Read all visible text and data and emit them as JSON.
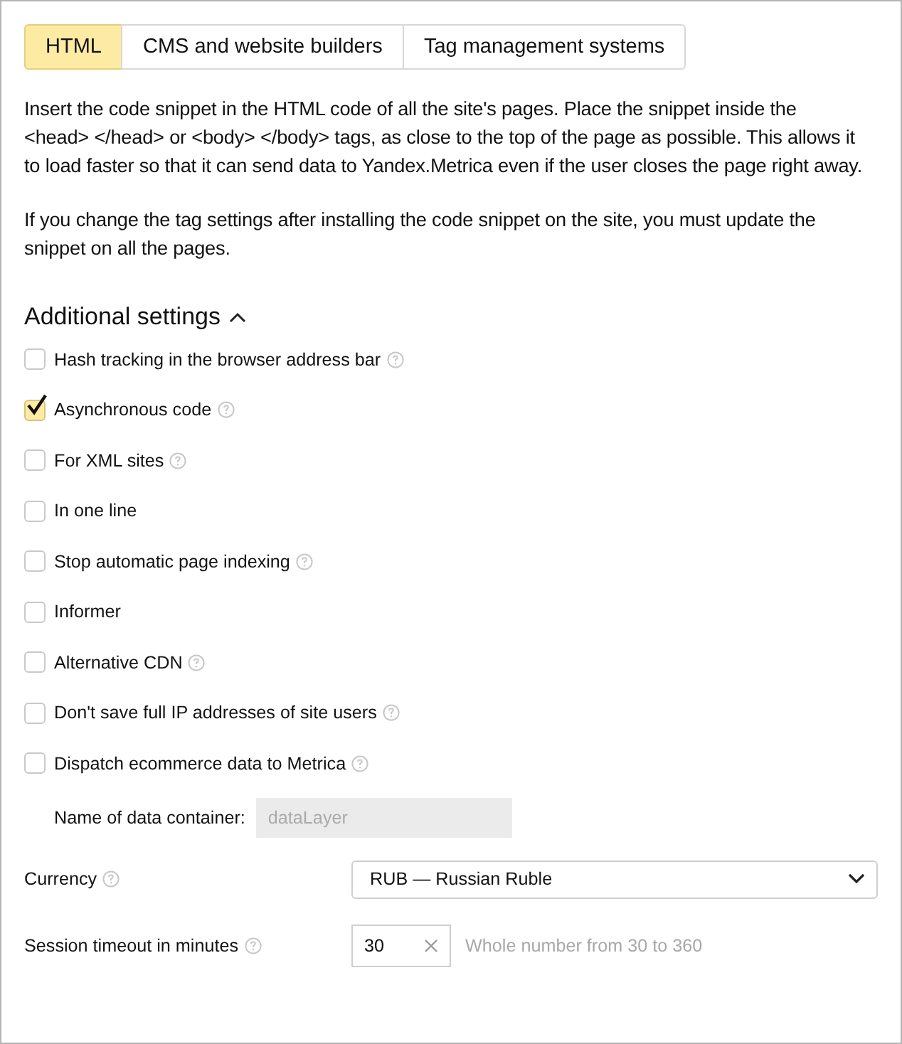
{
  "tabs": [
    {
      "label": "HTML",
      "selected": true
    },
    {
      "label": "CMS and website builders",
      "selected": false
    },
    {
      "label": "Tag management systems",
      "selected": false
    }
  ],
  "paragraphs": [
    "Insert the code snippet in the HTML code of all the site's pages. Place the snippet inside the <head> </head> or <body> </body> tags, as close to the top of the page as possible. This allows it to load faster so that it can send data to Yandex.Metrica even if the user closes the page right away.",
    "If you change the tag settings after installing the code snippet on the site, you must update the snippet on all the pages."
  ],
  "additional_settings": {
    "title": "Additional settings",
    "expanded": true,
    "options": [
      {
        "label": "Hash tracking in the browser address bar",
        "checked": false,
        "help": true
      },
      {
        "label": "Asynchronous code",
        "checked": true,
        "help": true
      },
      {
        "label": "For XML sites",
        "checked": false,
        "help": true
      },
      {
        "label": "In one line",
        "checked": false,
        "help": false
      },
      {
        "label": "Stop automatic page indexing",
        "checked": false,
        "help": true
      },
      {
        "label": "Informer",
        "checked": false,
        "help": false
      },
      {
        "label": "Alternative CDN",
        "checked": false,
        "help": true
      },
      {
        "label": "Don't save full IP addresses of site users",
        "checked": false,
        "help": true
      },
      {
        "label": "Dispatch ecommerce data to Metrica",
        "checked": false,
        "help": true
      }
    ],
    "data_container": {
      "label": "Name of data container:",
      "value": "dataLayer",
      "disabled": true
    },
    "currency": {
      "label": "Currency",
      "value": "RUB — Russian Ruble"
    },
    "session_timeout": {
      "label": "Session timeout in minutes",
      "value": "30",
      "hint": "Whole number from 30 to 360"
    }
  }
}
